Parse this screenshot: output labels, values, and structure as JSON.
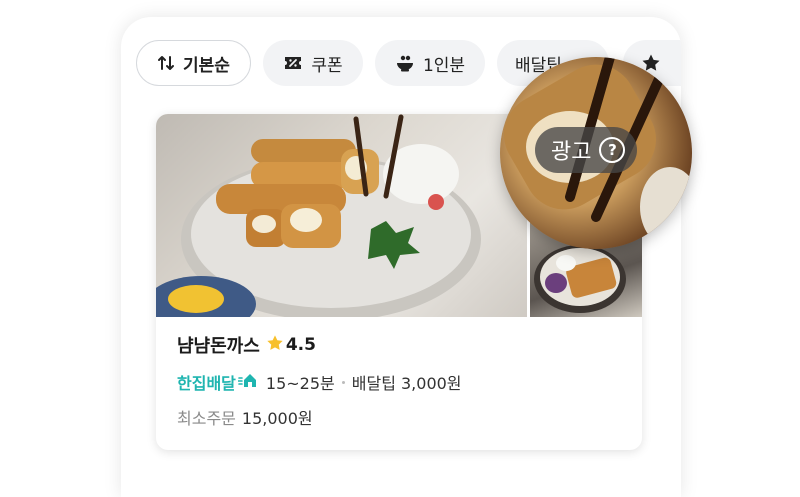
{
  "filters": [
    {
      "label": "기본순",
      "icon": "sort-icon",
      "active": true
    },
    {
      "label": "쿠폰",
      "icon": "coupon-icon",
      "active": false
    },
    {
      "label": "1인분",
      "icon": "single-portion-icon",
      "active": false
    },
    {
      "label": "배달팁",
      "icon": "",
      "active": false
    }
  ],
  "restaurant": {
    "name": "냠냠돈까스",
    "rating": "4.5",
    "delivery_type": "한집배달",
    "delivery_time": "15~25분",
    "delivery_tip": "배달팁 3,000원",
    "min_order_label": "최소주문",
    "min_order_value": "15,000원"
  },
  "ad": {
    "label": "광고",
    "help_symbol": "?"
  },
  "colors": {
    "accent": "#1fb5b0",
    "star": "#f7c02c",
    "chip_bg": "#f2f3f5"
  }
}
